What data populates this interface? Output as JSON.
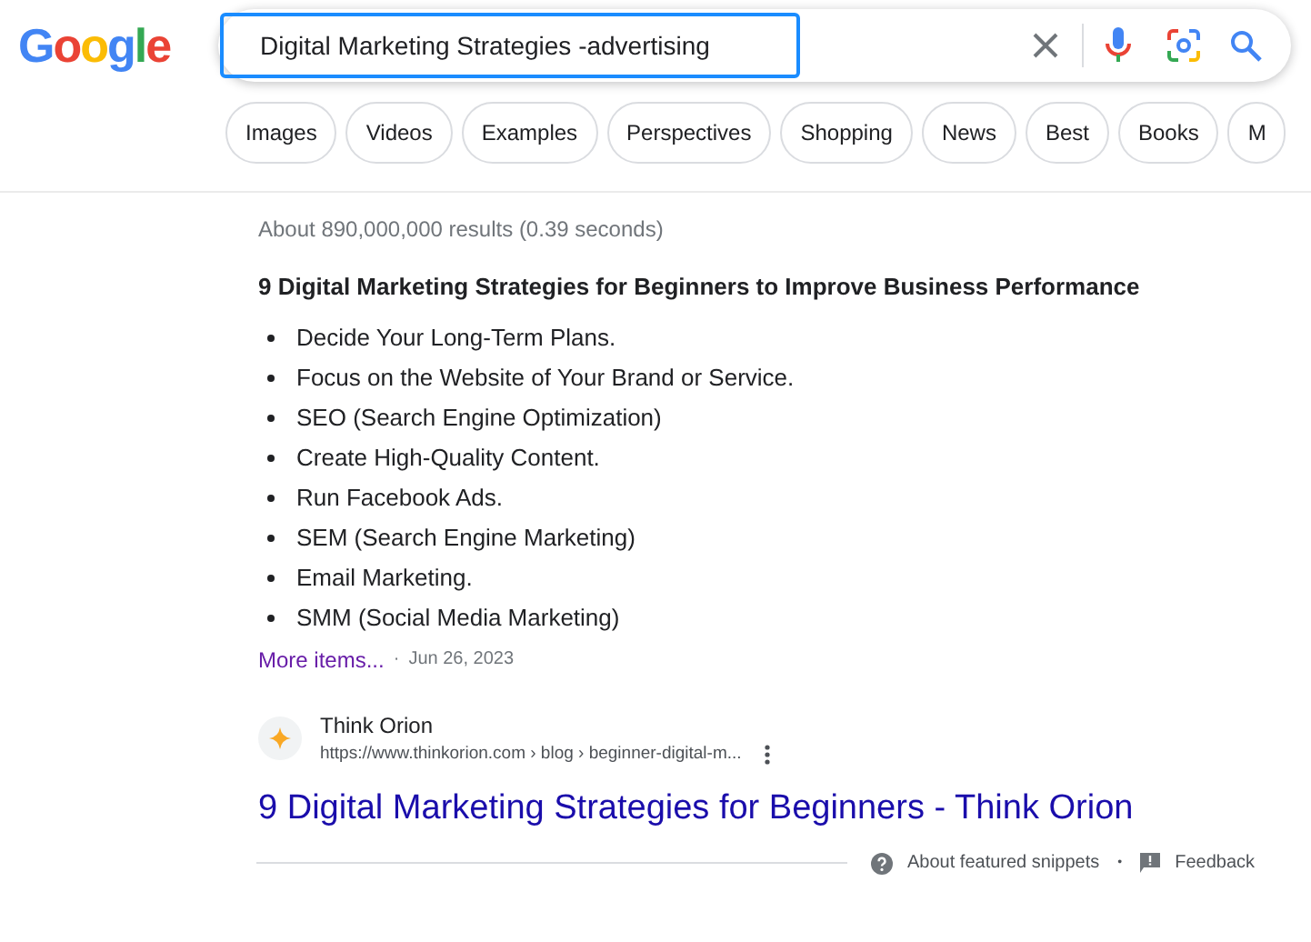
{
  "logo": "Google",
  "search": {
    "value": "Digital Marketing Strategies -advertising"
  },
  "chips": [
    "Images",
    "Videos",
    "Examples",
    "Perspectives",
    "Shopping",
    "News",
    "Best",
    "Books",
    "M"
  ],
  "result_stats": "About 890,000,000 results (0.39 seconds)",
  "snippet": {
    "heading": "9 Digital Marketing Strategies for Beginners to Improve Business Performance",
    "items": [
      "Decide Your Long-Term Plans.",
      "Focus on the Website of Your Brand or Service.",
      "SEO (Search Engine Optimization)",
      "Create High-Quality Content.",
      "Run Facebook Ads.",
      "SEM (Search Engine Marketing)",
      "Email Marketing.",
      "SMM (Social Media Marketing)"
    ],
    "more_link": "More items...",
    "separator": "·",
    "date": "Jun 26, 2023"
  },
  "source": {
    "site": "Think Orion",
    "breadcrumb": "https://www.thinkorion.com › blog › beginner-digital-m...",
    "title": "9 Digital Marketing Strategies for Beginners - Think Orion"
  },
  "footer": {
    "about": "About featured snippets",
    "separator": "•",
    "feedback": "Feedback"
  }
}
